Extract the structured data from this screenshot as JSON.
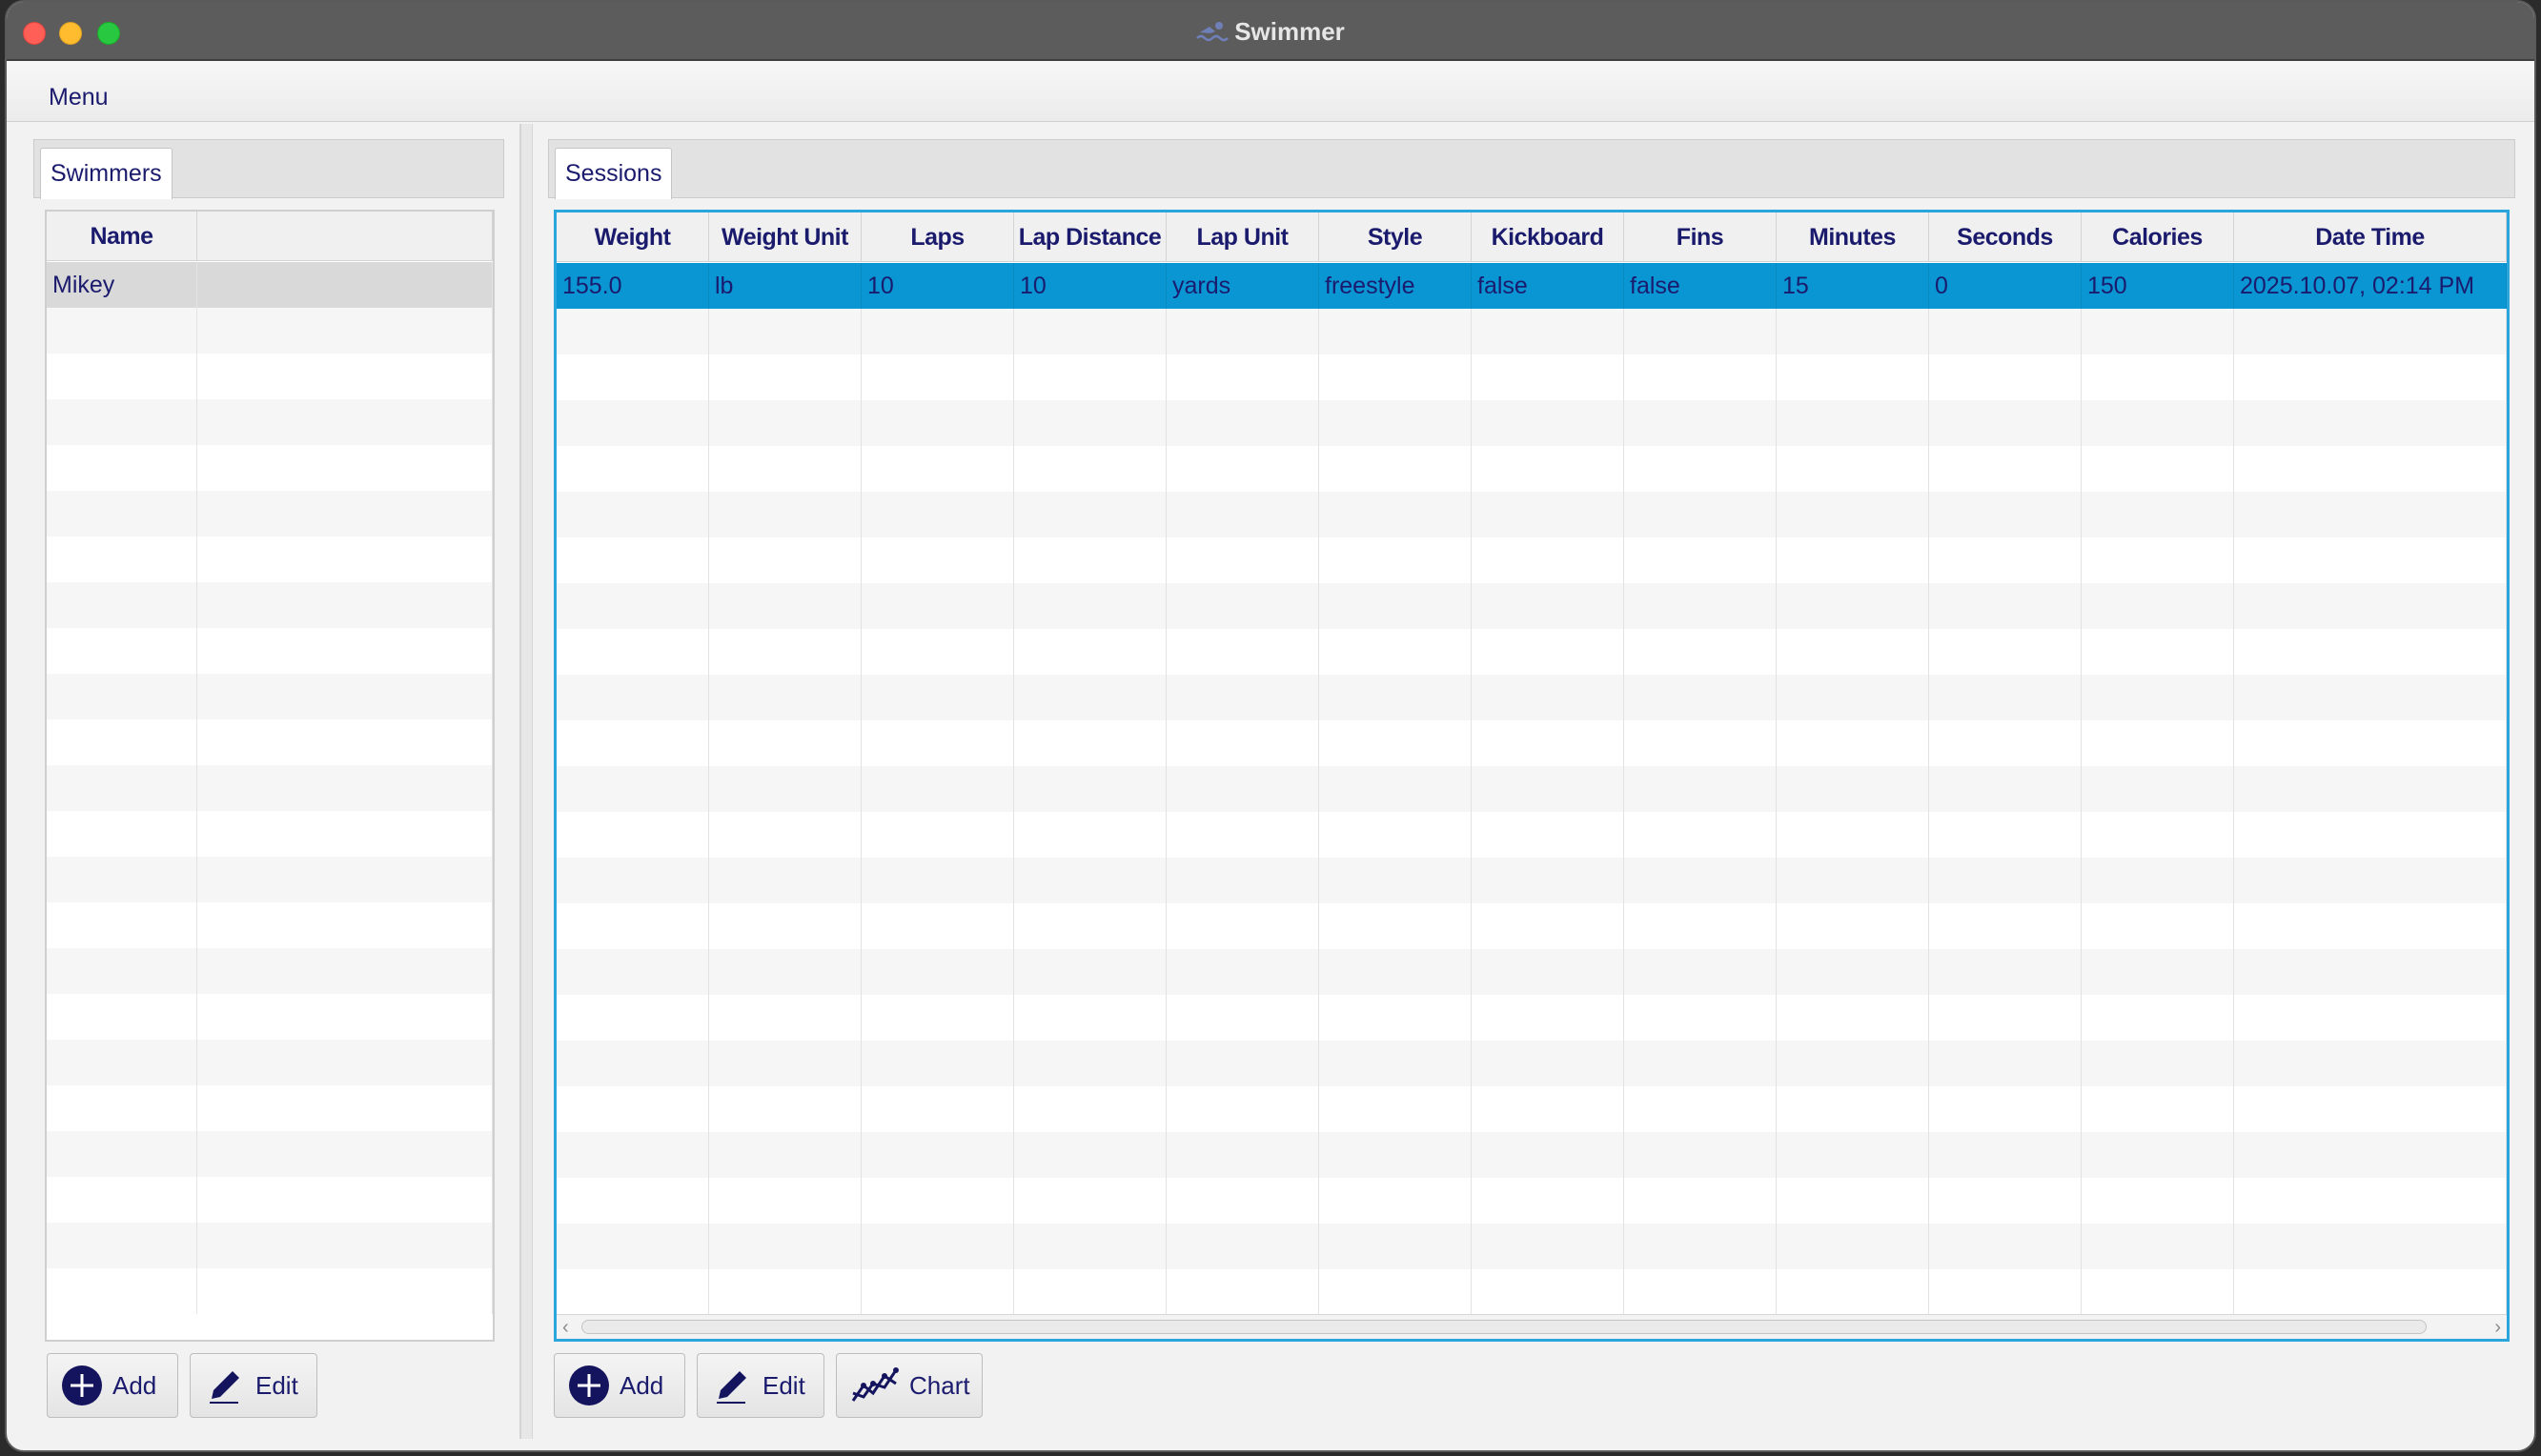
{
  "window": {
    "title": "Swimmer"
  },
  "menubar": {
    "menu_label": "Menu"
  },
  "swimmers": {
    "tab_label": "Swimmers",
    "columns": [
      "Name"
    ],
    "rows": [
      [
        "Mikey"
      ]
    ],
    "buttons": {
      "add": "Add",
      "edit": "Edit"
    }
  },
  "sessions": {
    "tab_label": "Sessions",
    "columns": [
      "Weight",
      "Weight Unit",
      "Laps",
      "Lap Distance",
      "Lap Unit",
      "Style",
      "Kickboard",
      "Fins",
      "Minutes",
      "Seconds",
      "Calories",
      "Date Time"
    ],
    "rows": [
      [
        "155.0",
        "lb",
        "10",
        "10",
        "yards",
        "freestyle",
        "false",
        "false",
        "15",
        "0",
        "150",
        "2025.10.07, 02:14 PM"
      ]
    ],
    "buttons": {
      "add": "Add",
      "edit": "Edit",
      "chart": "Chart"
    }
  },
  "colors": {
    "accent": "#0a96d2",
    "text": "#1b1b6e",
    "icon": "#14145e"
  },
  "icons": {
    "add": "plus-circle-icon",
    "edit": "pencil-icon",
    "chart": "line-chart-icon"
  }
}
